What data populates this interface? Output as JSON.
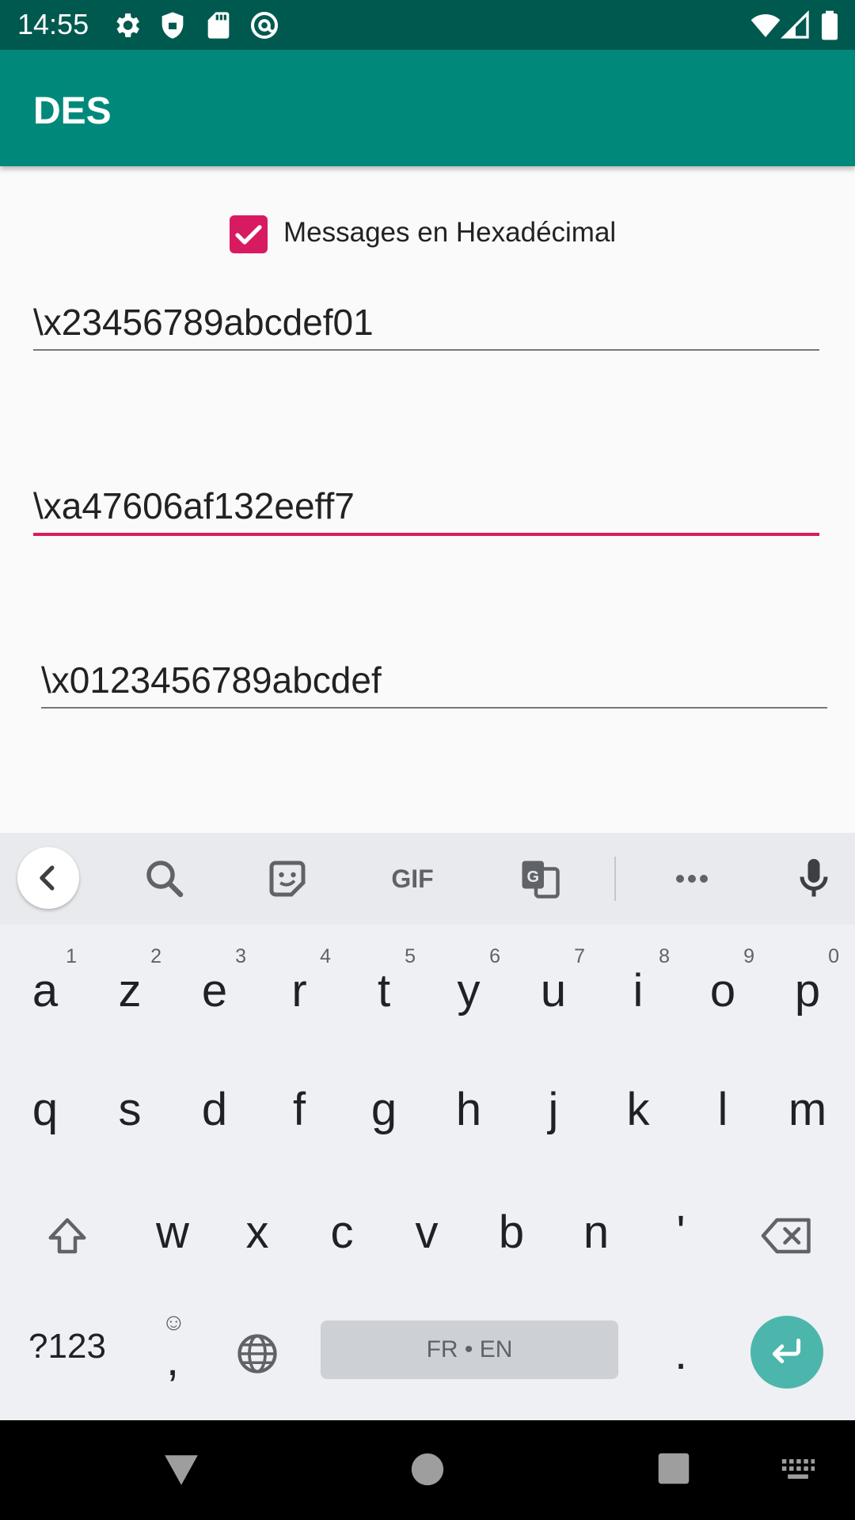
{
  "status_bar": {
    "time": "14:55",
    "left_icons": [
      "gear-icon",
      "shield-icon",
      "sd-card-icon",
      "at-sign-icon"
    ],
    "right_icons": [
      "wifi-icon",
      "signal-icon",
      "battery-icon"
    ]
  },
  "app_bar": {
    "title": "DES"
  },
  "checkbox": {
    "label": "Messages en Hexadécimal",
    "checked": true
  },
  "fields": {
    "key": {
      "value": "\\x23456789abcdef01"
    },
    "message": {
      "value": "\\xa47606af132eeff7"
    },
    "result": {
      "value": "\\x0123456789abcdef"
    }
  },
  "keyboard": {
    "toolbar": [
      "chevron-left-icon",
      "search-icon",
      "sticker-icon",
      "GIF",
      "translate-icon",
      "more-icon",
      "mic-icon"
    ],
    "row1": [
      {
        "k": "a",
        "h": "1"
      },
      {
        "k": "z",
        "h": "2"
      },
      {
        "k": "e",
        "h": "3"
      },
      {
        "k": "r",
        "h": "4"
      },
      {
        "k": "t",
        "h": "5"
      },
      {
        "k": "y",
        "h": "6"
      },
      {
        "k": "u",
        "h": "7"
      },
      {
        "k": "i",
        "h": "8"
      },
      {
        "k": "o",
        "h": "9"
      },
      {
        "k": "p",
        "h": "0"
      }
    ],
    "row2": [
      "q",
      "s",
      "d",
      "f",
      "g",
      "h",
      "j",
      "k",
      "l",
      "m"
    ],
    "row3": [
      "w",
      "x",
      "c",
      "v",
      "b",
      "n",
      "'"
    ],
    "symbols_key": "?123",
    "comma_key": ",",
    "space_label": "FR • EN",
    "period_key": "."
  },
  "colors": {
    "status_bar": "#00594f",
    "app_bar": "#00897b",
    "accent": "#d81b60",
    "enter_key": "#4db6ac"
  }
}
